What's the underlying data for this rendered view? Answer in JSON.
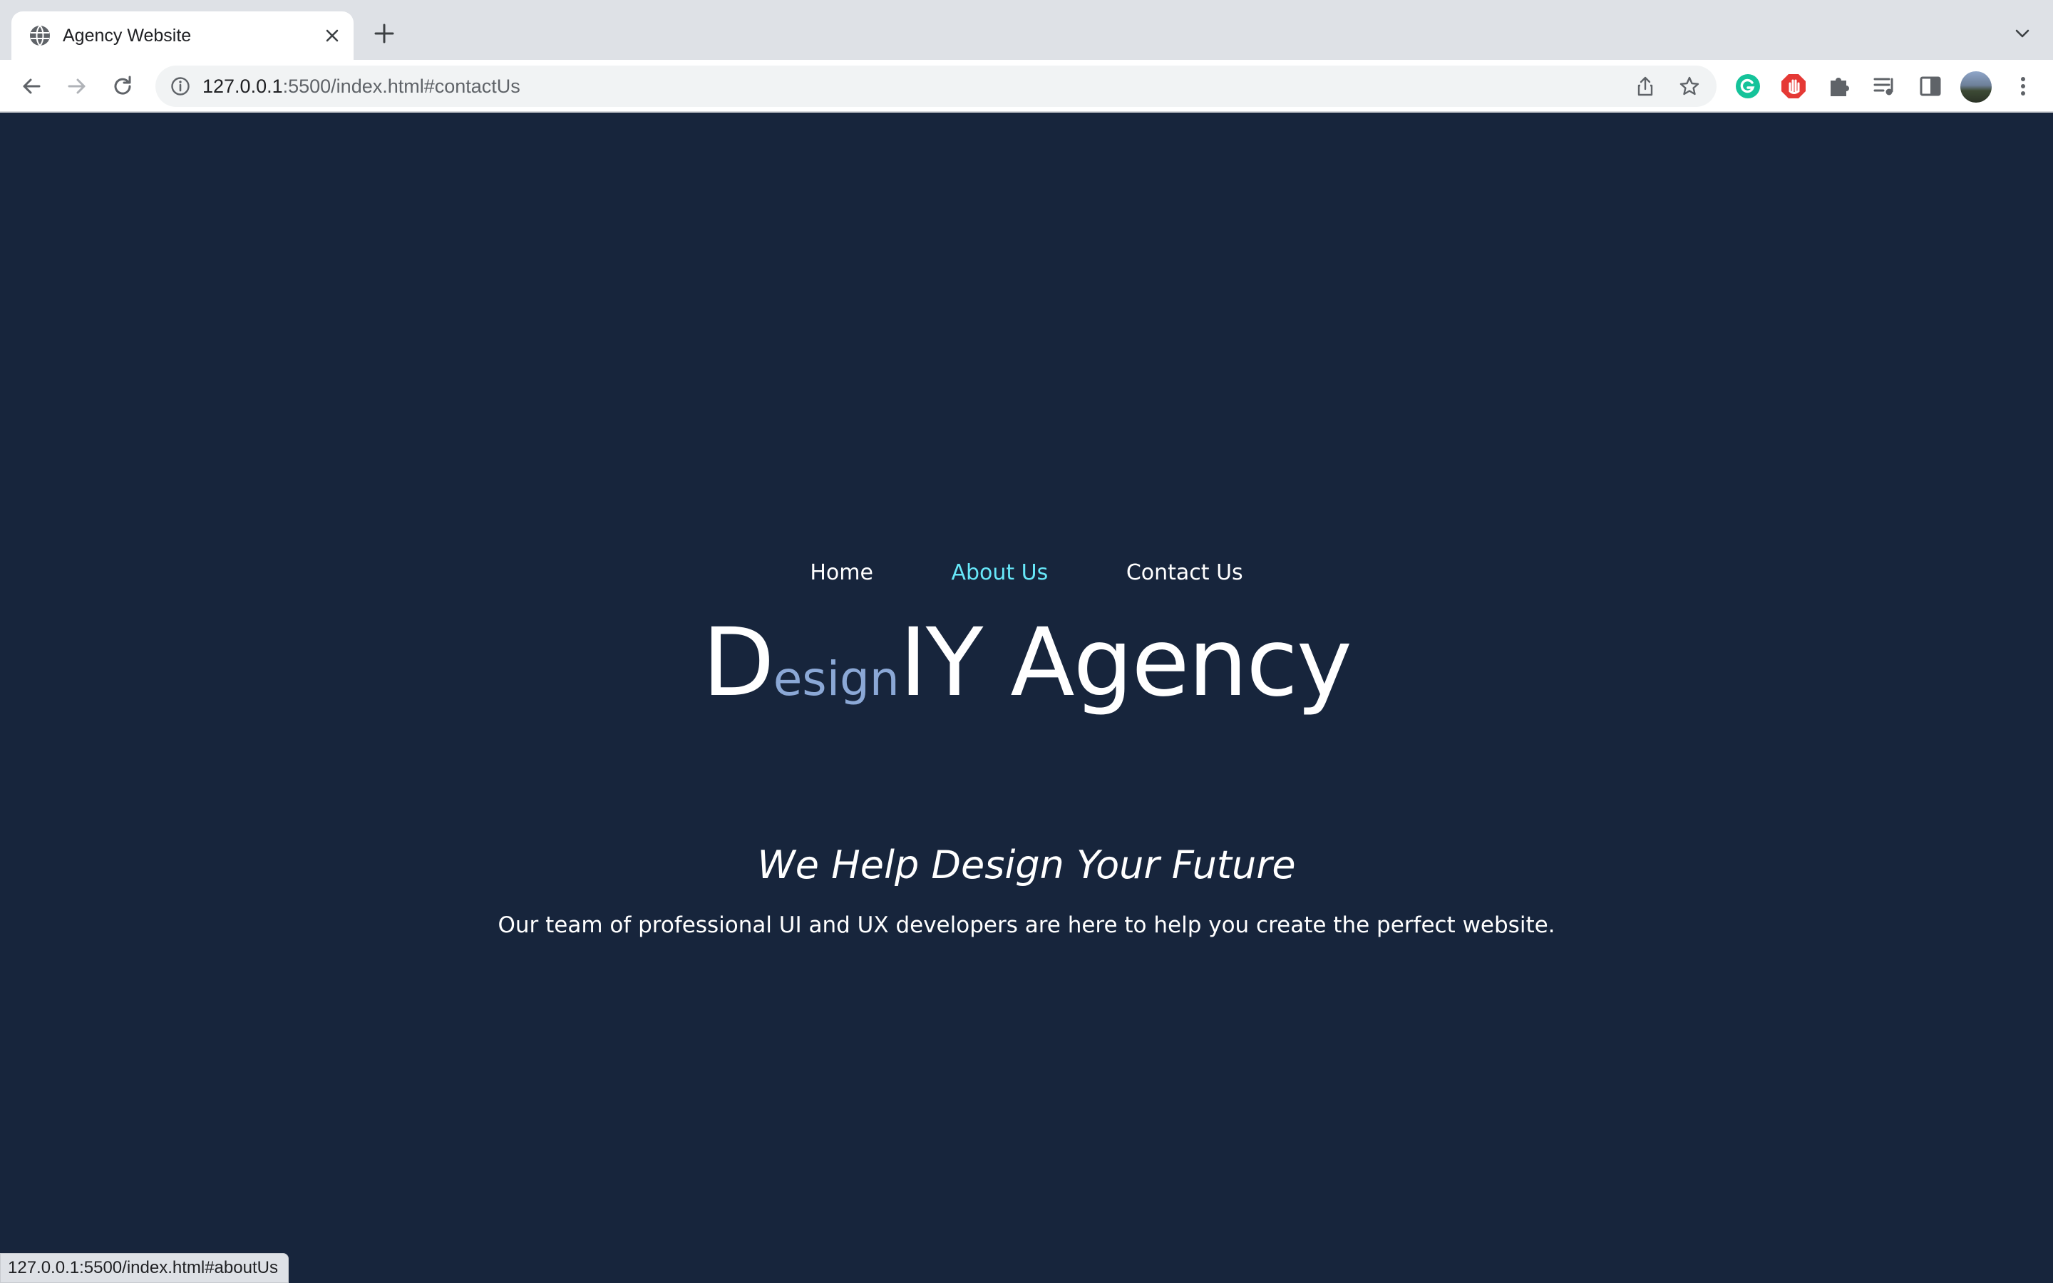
{
  "browser": {
    "tab": {
      "title": "Agency Website",
      "favicon": "globe-icon"
    },
    "omnibox": {
      "url_host": "127.0.0.1",
      "url_rest": ":5500/index.html#contactUs"
    },
    "extensions": [
      "grammarly-icon",
      "adblock-icon",
      "puzzle-icon",
      "media-control-icon",
      "side-panel-icon"
    ],
    "status_url": "127.0.0.1:5500/index.html#aboutUs"
  },
  "page": {
    "nav": [
      {
        "label": "Home",
        "active": false
      },
      {
        "label": "About Us",
        "active": true
      },
      {
        "label": "Contact Us",
        "active": false
      }
    ],
    "brand": {
      "first": "D",
      "small": "esign",
      "rest": "IY Agency"
    },
    "tagline": "We Help Design Your Future",
    "description": "Our team of professional UI and UX developers are here to help you create the perfect website."
  },
  "colors": {
    "background": "#17253c",
    "accent": "#67e8f9",
    "brand_small": "#8ba8d6",
    "text": "#ffffff"
  }
}
